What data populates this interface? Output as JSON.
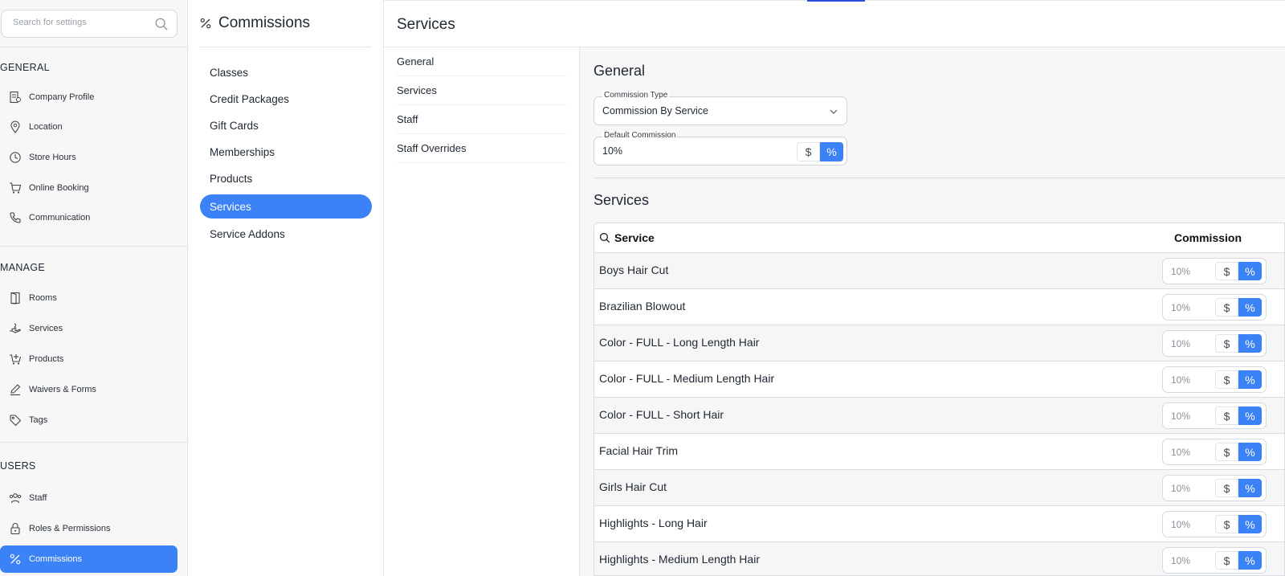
{
  "search": {
    "placeholder": "Search for settings"
  },
  "sidebar": {
    "sections": [
      {
        "heading": "GENERAL",
        "items": [
          {
            "label": "Company Profile",
            "icon": "company-profile-icon"
          },
          {
            "label": "Location",
            "icon": "map-pin-icon"
          },
          {
            "label": "Store Hours",
            "icon": "clock-icon"
          },
          {
            "label": "Online Booking",
            "icon": "cart-icon"
          },
          {
            "label": "Communication",
            "icon": "phone-icon"
          }
        ]
      },
      {
        "heading": "MANAGE",
        "items": [
          {
            "label": "Rooms",
            "icon": "door-icon"
          },
          {
            "label": "Services",
            "icon": "hand-icon"
          },
          {
            "label": "Products",
            "icon": "cart-plus-icon"
          },
          {
            "label": "Waivers & Forms",
            "icon": "pen-icon"
          },
          {
            "label": "Tags",
            "icon": "tag-icon"
          }
        ]
      },
      {
        "heading": "USERS",
        "items": [
          {
            "label": "Staff",
            "icon": "staff-icon"
          },
          {
            "label": "Roles & Permissions",
            "icon": "lock-icon"
          },
          {
            "label": "Commissions",
            "icon": "percent-icon",
            "active": true
          }
        ]
      }
    ]
  },
  "commissions_panel": {
    "title": "Commissions",
    "items": [
      "Classes",
      "Credit Packages",
      "Gift Cards",
      "Memberships",
      "Products",
      "Services",
      "Service Addons"
    ],
    "active": "Services"
  },
  "main": {
    "title": "Services",
    "subnav": [
      "General",
      "Services",
      "Staff",
      "Staff Overrides"
    ]
  },
  "general": {
    "heading": "General",
    "commission_type": {
      "label": "Commission Type",
      "value": "Commission By Service"
    },
    "default_commission": {
      "label": "Default Commission",
      "value": "10%",
      "dollar": "$",
      "percent": "%"
    }
  },
  "services_table": {
    "heading": "Services",
    "col_service": "Service",
    "col_commission": "Commission",
    "dollar": "$",
    "percent": "%",
    "rows": [
      {
        "name": "Boys Hair Cut",
        "value": "10%"
      },
      {
        "name": "Brazilian Blowout",
        "value": "10%"
      },
      {
        "name": "Color - FULL - Long Length Hair",
        "value": "10%"
      },
      {
        "name": "Color - FULL - Medium Length Hair",
        "value": "10%"
      },
      {
        "name": "Color - FULL - Short Hair",
        "value": "10%"
      },
      {
        "name": "Facial Hair Trim",
        "value": "10%"
      },
      {
        "name": "Girls Hair Cut",
        "value": "10%"
      },
      {
        "name": "Highlights - Long Hair",
        "value": "10%"
      },
      {
        "name": "Highlights - Medium Length Hair",
        "value": "10%"
      }
    ]
  },
  "colors": {
    "accent": "#3b82f6"
  }
}
